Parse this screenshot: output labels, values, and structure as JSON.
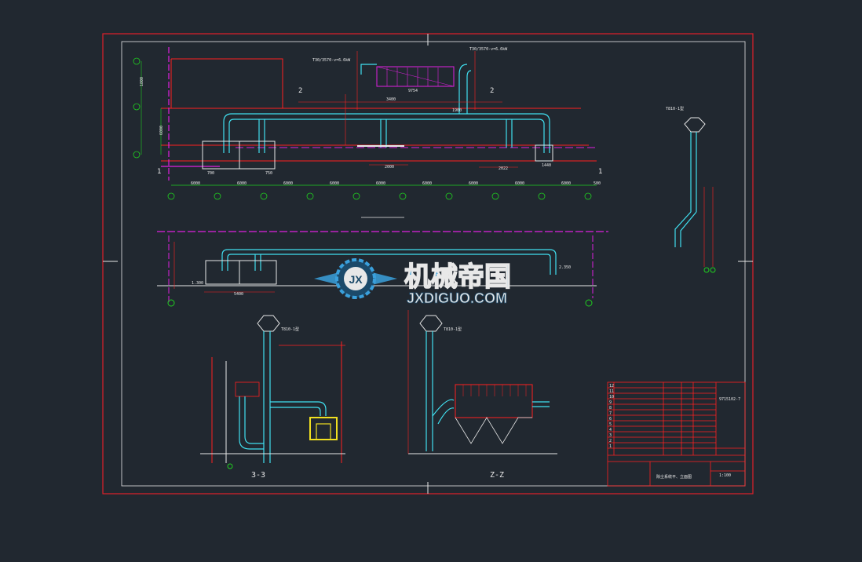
{
  "colors": {
    "background": "#212830",
    "frame": "#e0202a",
    "white": "#e8e8e8",
    "green": "#20d020",
    "magenta": "#e020e0",
    "cyan": "#40e0f0",
    "red": "#ff2020",
    "yellow": "#f0e020",
    "watermark": "#3aa0dc"
  },
  "section_labels": {
    "marker_1_left": "1",
    "marker_1_right": "1",
    "marker_2_left": "2",
    "marker_2_right": "2",
    "section_3_3": "3-3",
    "section_2_2": "Z-Z"
  },
  "plan_view": {
    "dims_top": [
      "700",
      "750",
      "3400",
      "9754",
      "1900",
      "2000",
      "1440",
      "2022"
    ],
    "dims_axis": [
      "6000",
      "6000",
      "6000",
      "6000",
      "6000",
      "6000",
      "6000",
      "6000",
      "6000",
      "6000",
      "500"
    ],
    "left_dims": [
      "1800",
      "6000"
    ],
    "note_top_left": "T30/3570-v=6.6kW",
    "note_top_right": "T30/3570-v=6.6kW"
  },
  "elevation_view": {
    "dims": [
      "5400",
      "7.200",
      "2.350",
      "1.300"
    ]
  },
  "stack_labels": {
    "stack_right": "T810-1型",
    "stack_3_3": "T810-1型",
    "stack_z_z": "T810-1型"
  },
  "title_block": {
    "rows": [
      "12",
      "11",
      "10",
      "9",
      "8",
      "7",
      "6",
      "5",
      "4",
      "3",
      "2",
      "1"
    ],
    "drawing_no": "9715102-7",
    "scale": "1:100",
    "project": "除尘系统平、立面图"
  },
  "watermark": {
    "cn": "机械帝国",
    "en": "JXDIGUO.COM",
    "logo_letters": "JX"
  }
}
